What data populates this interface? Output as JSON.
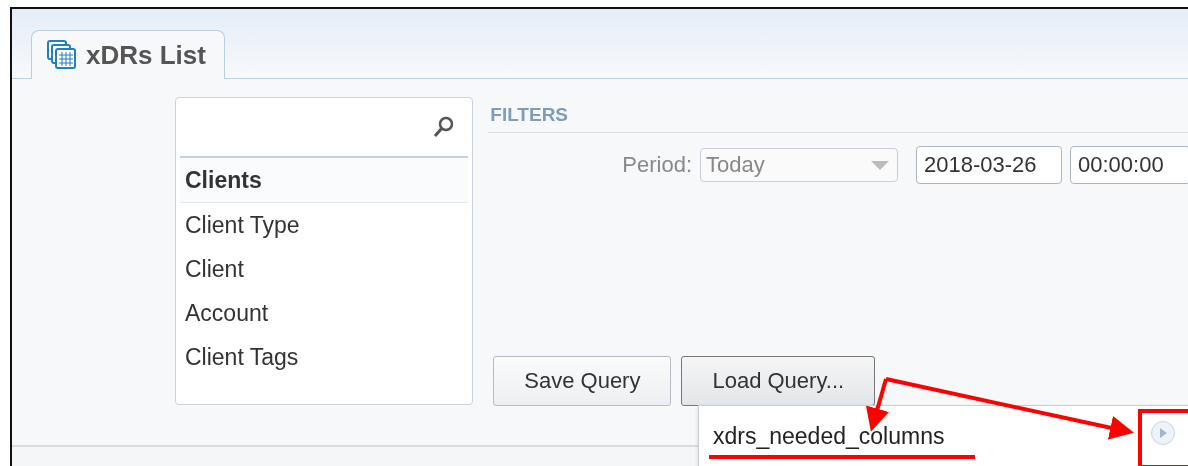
{
  "tabs": [
    {
      "label": "xDRs List",
      "selected": true
    }
  ],
  "field_list": {
    "items": [
      {
        "kind": "header",
        "label": "Clients"
      },
      {
        "kind": "item",
        "label": "Client Type"
      },
      {
        "kind": "item",
        "label": "Client"
      },
      {
        "kind": "item",
        "label": "Account"
      },
      {
        "kind": "item",
        "label": "Client Tags"
      }
    ]
  },
  "filters": {
    "title": "FILTERS",
    "period_label": "Period:",
    "period_value": "Today",
    "date": "2018-03-26",
    "time": "00:00:00"
  },
  "buttons": [
    {
      "label": "Save Query",
      "selected": false
    },
    {
      "label": "Load Query...",
      "selected": true
    }
  ],
  "query_menu": {
    "items": [
      {
        "label": "xdrs_needed_columns"
      }
    ]
  }
}
